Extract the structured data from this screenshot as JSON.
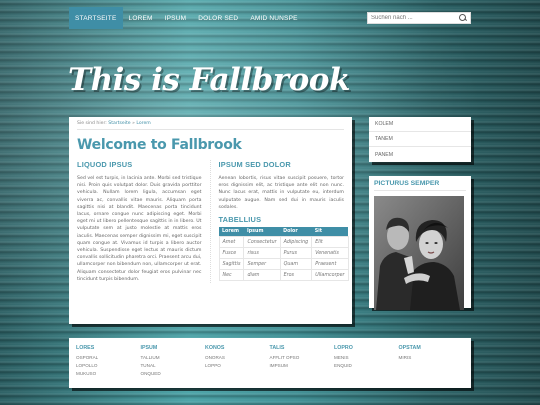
{
  "nav": {
    "items": [
      {
        "label": "STARTSEITE",
        "active": true
      },
      {
        "label": "LOREM",
        "active": false
      },
      {
        "label": "IPSUM",
        "active": false
      },
      {
        "label": "DOLOR SED",
        "active": false
      },
      {
        "label": "AMID NUNSPE",
        "active": false
      }
    ],
    "search": {
      "placeholder": "Suchen nach ...",
      "icon": "search-icon"
    }
  },
  "site": {
    "logo_text": "This is Fallbrook"
  },
  "breadcrumb": {
    "prefix": "Sie sind hier:",
    "home": "Startseite",
    "sep": "»",
    "current": "Lorem"
  },
  "page": {
    "title": "Welcome to Fallbrook",
    "left": {
      "heading": "LIQUOD IPSUS",
      "text": "Sed vel est turpis, in lacinia ante. Morbi sed tristique nisi. Proin quis volutpat dolor. Duis gravida porttitor vehicula. Nullam lorem ligula, accumsan eget viverra ac, convallis vitae mauris. Aliquam porta sagittis nisi at blandit. Maecenas porta tincidunt lacus, ornare congue nunc adipiscing eget. Morbi eget mi ut libero pellentesque sagittis in in libero. Ut vulputate sem at justo molestie at mattis eros iaculis. Maecenas semper dignissim mi, eget suscipit quam congue at. Vivamus id turpis a libero auctor vehicula. Suspendisse eget lectus at mauris dictum convallis sollicitudin pharetra orci. Praesent arcu dui, ullamcorper non bibendum non, ullamcorper ut erat. Aliquam consectetur dolor feugiat eros pulvinar nec tincidunt turpis bibendum."
    },
    "right": {
      "heading": "IPSUM SED DOLOR",
      "text": "Aenean lobortis, risus vitae suscipit posuere, tortor eros dignissim elit, ac tristique ante elit non nunc. Nunc lacus erat, mattis in vulputate eu, interdum vulputate augue. Nam sed dui in mauris iaculis sodales.",
      "table_heading": "TABELLIUS",
      "table": {
        "headers": [
          "Lorem",
          "Ipsum",
          "Dolor",
          "Sit"
        ],
        "rows": [
          [
            "Amet",
            "Consectetur",
            "Adipiscing",
            "Elit"
          ],
          [
            "Fusce",
            "risus",
            "Purus",
            "Venenatis"
          ],
          [
            "Sagittis",
            "Semper",
            "Quam",
            "Praesent"
          ],
          [
            "Nec",
            "diam",
            "Eros",
            "Ullamcorper"
          ]
        ]
      }
    }
  },
  "sidebar": {
    "menu": [
      "KOLEM",
      "TANEM",
      "PANEM"
    ],
    "picture_heading": "PICTURUS SEMPER"
  },
  "footer": {
    "columns": [
      {
        "heading": "LORES",
        "links": [
          "OSPORAL",
          "LOPOLLO",
          "MUKUSO"
        ]
      },
      {
        "heading": "IPSUM",
        "links": [
          "TALLIUM",
          "TUNAL",
          "ONQUED"
        ]
      },
      {
        "heading": "KONOS",
        "links": [
          "ONORAS",
          "LOPPO"
        ]
      },
      {
        "heading": "TALIS",
        "links": [
          "AFFLIT OPSO",
          "IMPSUM"
        ]
      },
      {
        "heading": "LOPRO",
        "links": [
          "MENIS",
          "ENQUID"
        ]
      },
      {
        "heading": "OPSTAM",
        "links": [
          "MIRIS"
        ]
      }
    ]
  },
  "colors": {
    "accent": "#4a98ad",
    "nav_active": "#3f8ea6",
    "background": "#2f6a6c"
  }
}
